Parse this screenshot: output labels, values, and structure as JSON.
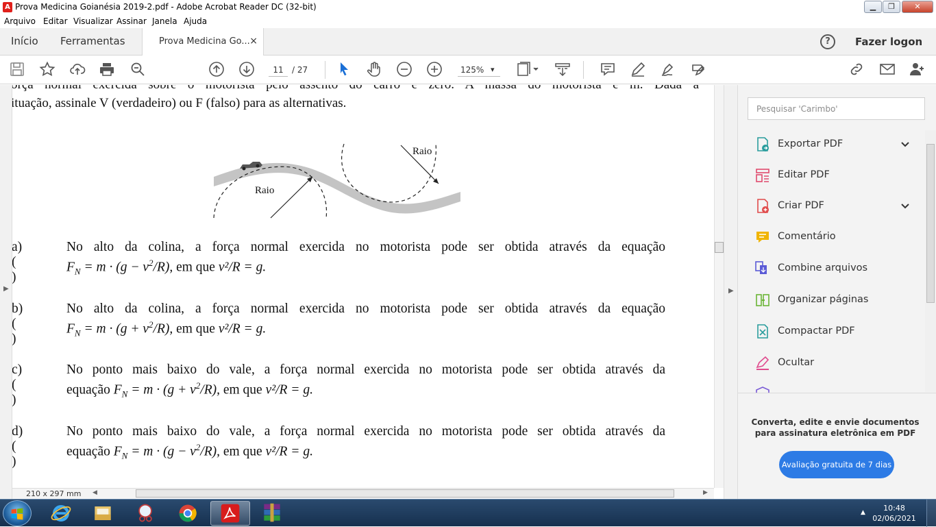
{
  "window": {
    "title": "Prova Medicina  Goianésia 2019-2.pdf - Adobe Acrobat Reader DC (32-bit)",
    "app_icon": "acrobat-icon",
    "buttons": [
      "minimize",
      "maximize",
      "close"
    ]
  },
  "menu": [
    "Arquivo",
    "Editar",
    "Visualizar",
    "Assinar",
    "Janela",
    "Ajuda"
  ],
  "tabs": {
    "home": "Início",
    "tools": "Ferramentas",
    "document": "Prova Medicina  Go...",
    "close_glyph": "×",
    "help_glyph": "?",
    "login": "Fazer logon"
  },
  "toolbar": {
    "page_current": "11",
    "page_total": "/ 27",
    "zoom": "125%",
    "zoom_caret": "▾"
  },
  "document": {
    "intro_line1": "orça normal exercida sobre o motorista pelo assento do carro é zero. A massa do motorista é m. Dada a",
    "intro_line2": "ituação, assinale V (verdadeiro) ou F (falso) para as alternativas.",
    "figure_labels": [
      "Raio",
      "Raio"
    ],
    "items": [
      {
        "label": "a) (     )",
        "text": "No alto da colina, a força normal exercida no motorista pode ser obtida através da equação",
        "prefix": "",
        "eq": "F",
        "sub": "N",
        "mid": " = m · (g − v",
        "sup": "2",
        "den": "/R), ",
        "tail": "em que",
        "cond": " v²/R = g."
      },
      {
        "label": "b) (     )",
        "text": "No alto da colina, a força normal exercida no motorista pode ser obtida através da equação",
        "prefix": "",
        "eq": "F",
        "sub": "N",
        "mid": " = m · (g + v",
        "sup": "2",
        "den": "/R), ",
        "tail": "em que",
        "cond": " v²/R = g."
      },
      {
        "label": "c) (     )",
        "text": "No ponto mais baixo do vale, a força normal exercida no motorista pode ser obtida através da",
        "prefix": "equação ",
        "eq": "F",
        "sub": "N",
        "mid": " = m · (g + v",
        "sup": "2",
        "den": "/R), ",
        "tail": "em que",
        "cond": " v²/R = g."
      },
      {
        "label": "d) (     )",
        "text": "No ponto mais baixo do vale, a força normal exercida no motorista pode ser obtida através da",
        "prefix": "equação ",
        "eq": "F",
        "sub": "N",
        "mid": " = m · (g − v",
        "sup": "2",
        "den": "/R), ",
        "tail": "em que",
        "cond": " v²/R = g."
      }
    ],
    "page_size": "210 x 297 mm"
  },
  "right_pane": {
    "search_placeholder": "Pesquisar 'Carimbo'",
    "tools": [
      {
        "label": "Exportar PDF",
        "icon": "export-pdf-icon",
        "color": "#2a9d9d",
        "expand": true
      },
      {
        "label": "Editar PDF",
        "icon": "edit-pdf-icon",
        "color": "#e04b6e",
        "expand": false
      },
      {
        "label": "Criar PDF",
        "icon": "create-pdf-icon",
        "color": "#e04b4b",
        "expand": true
      },
      {
        "label": "Comentário",
        "icon": "comment-icon",
        "color": "#f0b400",
        "expand": false
      },
      {
        "label": "Combine arquivos",
        "icon": "combine-files-icon",
        "color": "#5b5bd6",
        "expand": false
      },
      {
        "label": "Organizar páginas",
        "icon": "organize-pages-icon",
        "color": "#6bb536",
        "expand": false
      },
      {
        "label": "Compactar PDF",
        "icon": "compress-pdf-icon",
        "color": "#2a9d9d",
        "expand": false
      },
      {
        "label": "Ocultar",
        "icon": "redact-icon",
        "color": "#e04b8e",
        "expand": false
      }
    ],
    "promo_text": "Converta, edite e envie documentos para assinatura eletrônica em PDF",
    "trial_button": "Avaliação gratuita de 7 dias"
  },
  "taskbar": {
    "time": "10:48",
    "date": "02/06/2021",
    "apps": [
      "internet-explorer-icon",
      "file-explorer-icon",
      "snipping-tool-icon",
      "chrome-icon",
      "acrobat-icon",
      "winrar-icon"
    ]
  },
  "colors": {
    "accent": "#2d7be5",
    "taskbar": "#1f3b5e"
  }
}
